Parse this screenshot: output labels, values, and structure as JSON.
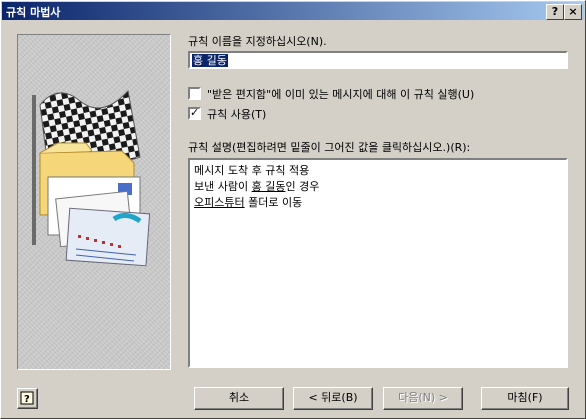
{
  "window": {
    "title": "규칙 마법사",
    "help_button": "?",
    "close_button": "×"
  },
  "name_section": {
    "label": "규칙 이름을 지정하십시오(N).",
    "value": "홍 길동"
  },
  "options": {
    "apply_existing": {
      "label": "\"받은 편지함\"에 이미 있는 메시지에 대해 이 규칙 실행(U)",
      "checked": false
    },
    "enable_rule": {
      "label": "규칙 사용(T)",
      "checked": true
    }
  },
  "description": {
    "label": "규칙 설명(편집하려면 밑줄이 그어진 값을 클릭하십시오.)(R):",
    "line1": "메시지 도착 후 규칙 적용",
    "line2_prefix": "보낸 사람이 ",
    "line2_link": "홍 길동",
    "line2_suffix": "인 경우",
    "line3_link": "오피스튜터",
    "line3_suffix": " 폴더로 이동"
  },
  "buttons": {
    "cancel": "취소",
    "back": "< 뒤로(B)",
    "next": "다음(N) >",
    "finish": "마침(F)"
  },
  "icons": {
    "wizard_art": "checkered-flag-mail-icon",
    "help_icon": "question-help-icon"
  }
}
